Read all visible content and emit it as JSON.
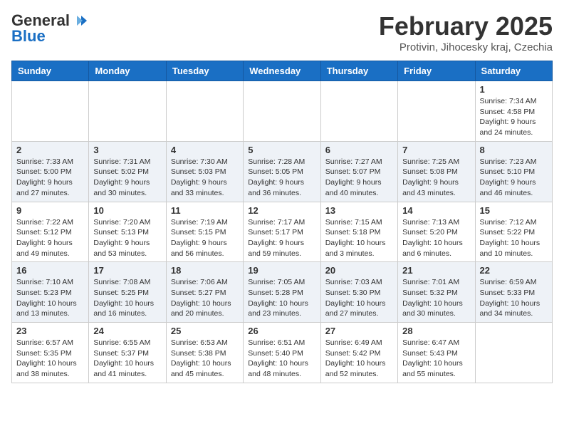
{
  "header": {
    "logo_general": "General",
    "logo_blue": "Blue",
    "title": "February 2025",
    "location": "Protivin, Jihocesky kraj, Czechia"
  },
  "days_of_week": [
    "Sunday",
    "Monday",
    "Tuesday",
    "Wednesday",
    "Thursday",
    "Friday",
    "Saturday"
  ],
  "weeks": [
    [
      {
        "day": "",
        "info": ""
      },
      {
        "day": "",
        "info": ""
      },
      {
        "day": "",
        "info": ""
      },
      {
        "day": "",
        "info": ""
      },
      {
        "day": "",
        "info": ""
      },
      {
        "day": "",
        "info": ""
      },
      {
        "day": "1",
        "info": "Sunrise: 7:34 AM\nSunset: 4:58 PM\nDaylight: 9 hours and 24 minutes."
      }
    ],
    [
      {
        "day": "2",
        "info": "Sunrise: 7:33 AM\nSunset: 5:00 PM\nDaylight: 9 hours and 27 minutes."
      },
      {
        "day": "3",
        "info": "Sunrise: 7:31 AM\nSunset: 5:02 PM\nDaylight: 9 hours and 30 minutes."
      },
      {
        "day": "4",
        "info": "Sunrise: 7:30 AM\nSunset: 5:03 PM\nDaylight: 9 hours and 33 minutes."
      },
      {
        "day": "5",
        "info": "Sunrise: 7:28 AM\nSunset: 5:05 PM\nDaylight: 9 hours and 36 minutes."
      },
      {
        "day": "6",
        "info": "Sunrise: 7:27 AM\nSunset: 5:07 PM\nDaylight: 9 hours and 40 minutes."
      },
      {
        "day": "7",
        "info": "Sunrise: 7:25 AM\nSunset: 5:08 PM\nDaylight: 9 hours and 43 minutes."
      },
      {
        "day": "8",
        "info": "Sunrise: 7:23 AM\nSunset: 5:10 PM\nDaylight: 9 hours and 46 minutes."
      }
    ],
    [
      {
        "day": "9",
        "info": "Sunrise: 7:22 AM\nSunset: 5:12 PM\nDaylight: 9 hours and 49 minutes."
      },
      {
        "day": "10",
        "info": "Sunrise: 7:20 AM\nSunset: 5:13 PM\nDaylight: 9 hours and 53 minutes."
      },
      {
        "day": "11",
        "info": "Sunrise: 7:19 AM\nSunset: 5:15 PM\nDaylight: 9 hours and 56 minutes."
      },
      {
        "day": "12",
        "info": "Sunrise: 7:17 AM\nSunset: 5:17 PM\nDaylight: 9 hours and 59 minutes."
      },
      {
        "day": "13",
        "info": "Sunrise: 7:15 AM\nSunset: 5:18 PM\nDaylight: 10 hours and 3 minutes."
      },
      {
        "day": "14",
        "info": "Sunrise: 7:13 AM\nSunset: 5:20 PM\nDaylight: 10 hours and 6 minutes."
      },
      {
        "day": "15",
        "info": "Sunrise: 7:12 AM\nSunset: 5:22 PM\nDaylight: 10 hours and 10 minutes."
      }
    ],
    [
      {
        "day": "16",
        "info": "Sunrise: 7:10 AM\nSunset: 5:23 PM\nDaylight: 10 hours and 13 minutes."
      },
      {
        "day": "17",
        "info": "Sunrise: 7:08 AM\nSunset: 5:25 PM\nDaylight: 10 hours and 16 minutes."
      },
      {
        "day": "18",
        "info": "Sunrise: 7:06 AM\nSunset: 5:27 PM\nDaylight: 10 hours and 20 minutes."
      },
      {
        "day": "19",
        "info": "Sunrise: 7:05 AM\nSunset: 5:28 PM\nDaylight: 10 hours and 23 minutes."
      },
      {
        "day": "20",
        "info": "Sunrise: 7:03 AM\nSunset: 5:30 PM\nDaylight: 10 hours and 27 minutes."
      },
      {
        "day": "21",
        "info": "Sunrise: 7:01 AM\nSunset: 5:32 PM\nDaylight: 10 hours and 30 minutes."
      },
      {
        "day": "22",
        "info": "Sunrise: 6:59 AM\nSunset: 5:33 PM\nDaylight: 10 hours and 34 minutes."
      }
    ],
    [
      {
        "day": "23",
        "info": "Sunrise: 6:57 AM\nSunset: 5:35 PM\nDaylight: 10 hours and 38 minutes."
      },
      {
        "day": "24",
        "info": "Sunrise: 6:55 AM\nSunset: 5:37 PM\nDaylight: 10 hours and 41 minutes."
      },
      {
        "day": "25",
        "info": "Sunrise: 6:53 AM\nSunset: 5:38 PM\nDaylight: 10 hours and 45 minutes."
      },
      {
        "day": "26",
        "info": "Sunrise: 6:51 AM\nSunset: 5:40 PM\nDaylight: 10 hours and 48 minutes."
      },
      {
        "day": "27",
        "info": "Sunrise: 6:49 AM\nSunset: 5:42 PM\nDaylight: 10 hours and 52 minutes."
      },
      {
        "day": "28",
        "info": "Sunrise: 6:47 AM\nSunset: 5:43 PM\nDaylight: 10 hours and 55 minutes."
      },
      {
        "day": "",
        "info": ""
      }
    ]
  ]
}
